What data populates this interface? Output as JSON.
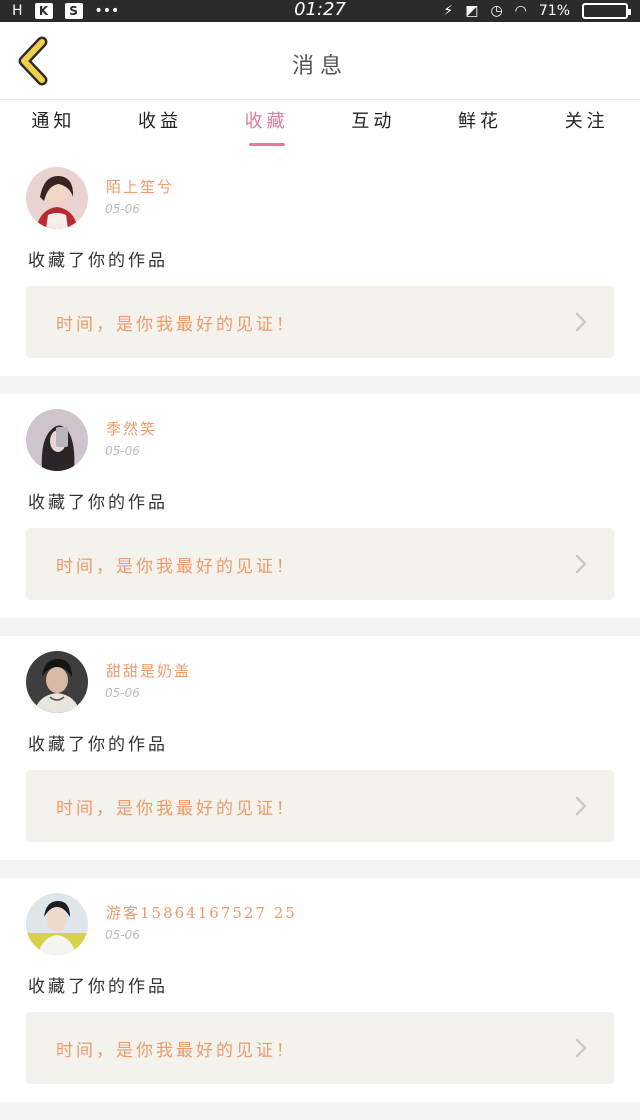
{
  "status_bar": {
    "left_text": "H",
    "box1": "K",
    "box2": "S",
    "dots": "•••",
    "time": "01:27",
    "battery_text": "71%"
  },
  "header": {
    "title": "消息"
  },
  "tabs": [
    {
      "label": "通知"
    },
    {
      "label": "收益"
    },
    {
      "label": "收藏",
      "active": true
    },
    {
      "label": "互动"
    },
    {
      "label": "鲜花"
    },
    {
      "label": "关注"
    }
  ],
  "messages": [
    {
      "user": "陌上笙兮",
      "date": "05-06",
      "action": "收藏了你的作品",
      "work_title": "时间，是你我最好的见证！"
    },
    {
      "user": "季然笑",
      "date": "05-06",
      "action": "收藏了你的作品",
      "work_title": "时间，是你我最好的见证！"
    },
    {
      "user": "甜甜是奶盖",
      "date": "05-06",
      "action": "收藏了你的作品",
      "work_title": "时间，是你我最好的见证！"
    },
    {
      "user": "游客15864167527 25",
      "date": "05-06",
      "action": "收藏了你的作品",
      "work_title": "时间，是你我最好的见证！"
    }
  ],
  "colors": {
    "accent": "#e07aa0",
    "username": "#ef9a6a",
    "back_arrow": "#f2d04a"
  },
  "icons": {
    "back": "chevron-left-icon",
    "row_arrow": "chevron-right-icon"
  }
}
